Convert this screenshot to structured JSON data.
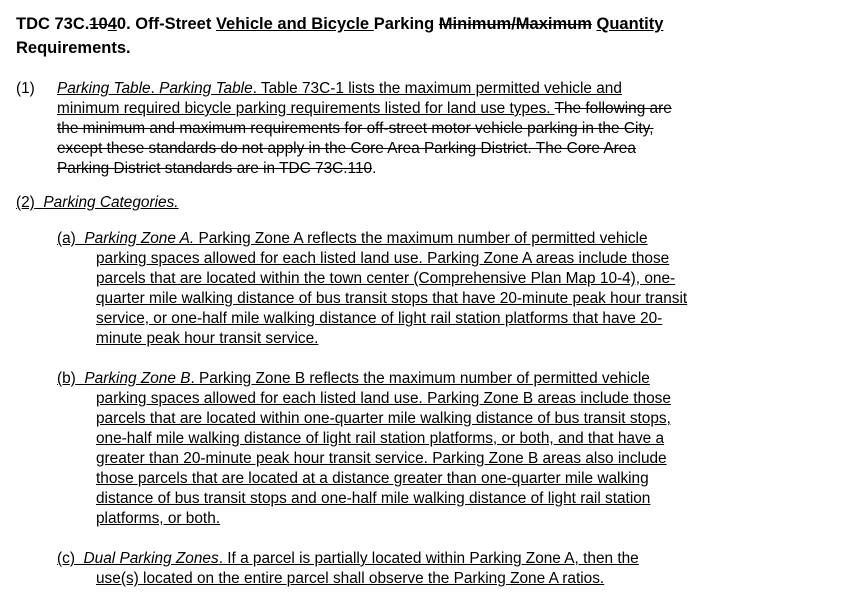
{
  "heading": {
    "p1": "TDC 73C.",
    "p2_strike": "10",
    "p3_underline": "4",
    "p4": "0. Off-Street ",
    "p5_underline": "Vehicle and Bicycle ",
    "p6": "Parking ",
    "p7_strike": "Minimum/Maximum",
    "p8": " ",
    "p9_underline": "Quantity",
    "p10": "Requirements."
  },
  "section1": {
    "number": "(1)",
    "title": "Parking Table",
    "title_repeat": "Parking Table",
    "line1_rest": ". Table 73C-1 lists the maximum permitted vehicle and",
    "line2": "minimum required bicycle parking requirements listed for land use types. ",
    "line2_strike": "The following are",
    "line3_strike": "the minimum and maximum requirements for off-street motor vehicle parking in the City,",
    "line4_strike": "except these standards do not apply in the Core Area Parking District. The Core Area",
    "line5_strike": "Parking District standards are in TDC 73C.110",
    "line5_end": "."
  },
  "section2": {
    "number": "(2)",
    "title": "Parking Categories."
  },
  "item_a": {
    "number": "(a)",
    "title": "Parking Zone A.",
    "lines": [
      " Parking Zone A reflects the maximum number of permitted vehicle",
      "parking spaces allowed for each listed land use. Parking Zone A areas include those",
      "parcels that are located within the town center (Comprehensive Plan Map 10-4), one-",
      "quarter mile walking distance of bus transit stops that have 20-minute peak hour transit",
      "service, or one-half mile walking distance of light rail station platforms that have 20-",
      "minute peak hour transit service."
    ]
  },
  "item_b": {
    "number": "(b)",
    "title": "Parking Zone B",
    "lines": [
      ". Parking Zone B reflects the maximum number of permitted vehicle",
      "parking spaces allowed for each listed land use. Parking Zone B areas include those",
      "parcels that are located within one-quarter mile walking distance of bus transit stops,",
      "one-half mile walking distance of light rail station platforms, or both, and that have a",
      "greater than 20-minute peak hour transit service. Parking Zone B areas also include",
      "those parcels that are located at a distance greater than one-quarter mile walking",
      "distance of bus transit stops and one-half mile walking distance of light rail station",
      "platforms, or both."
    ]
  },
  "item_c": {
    "number": "(c)",
    "title": "Dual Parking Zones",
    "lines": [
      ". If a parcel is partially located within Parking Zone A, then the",
      "use(s) located on the entire parcel shall observe the Parking Zone A ratios."
    ]
  }
}
